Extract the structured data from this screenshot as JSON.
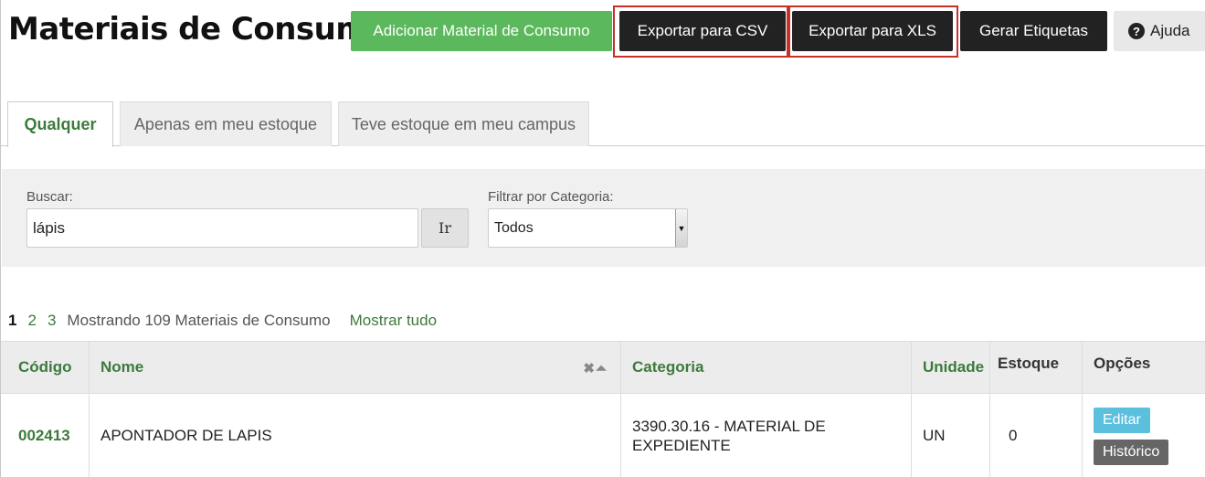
{
  "header": {
    "title": "Materiais de Consumo",
    "add_label": "Adicionar Material de Consumo",
    "csv_label": "Exportar para CSV",
    "xls_label": "Exportar para XLS",
    "tags_label": "Gerar Etiquetas",
    "help_label": "Ajuda",
    "help_icon": "?"
  },
  "tabs": [
    {
      "label": "Qualquer",
      "active": true
    },
    {
      "label": "Apenas em meu estoque",
      "active": false
    },
    {
      "label": "Teve estoque em meu campus",
      "active": false
    }
  ],
  "filters": {
    "search_label": "Buscar:",
    "search_value": "lápis",
    "go_label": "Ir",
    "category_label": "Filtrar por Categoria:",
    "category_value": "Todos"
  },
  "pagination": {
    "pages": [
      "1",
      "2",
      "3"
    ],
    "current": "1",
    "info": "Mostrando 109 Materiais de Consumo",
    "show_all": "Mostrar tudo"
  },
  "table": {
    "headers": {
      "code": "Código",
      "name": "Nome",
      "category": "Categoria",
      "unit": "Unidade",
      "stock": "Estoque",
      "options": "Opções"
    },
    "sort_icons": "✖⏶",
    "rows": [
      {
        "code": "002413",
        "name": "APONTADOR DE LAPIS",
        "category": "3390.30.16 - MATERIAL DE EXPEDIENTE",
        "unit": "UN",
        "stock": "0",
        "edit_label": "Editar",
        "history_label": "Histórico"
      }
    ]
  },
  "colors": {
    "accent_green": "#3d7a3d",
    "button_green": "#5cb85c",
    "button_dark": "#222222",
    "highlight_red": "#c9302c",
    "edit_blue": "#5bc0de"
  }
}
